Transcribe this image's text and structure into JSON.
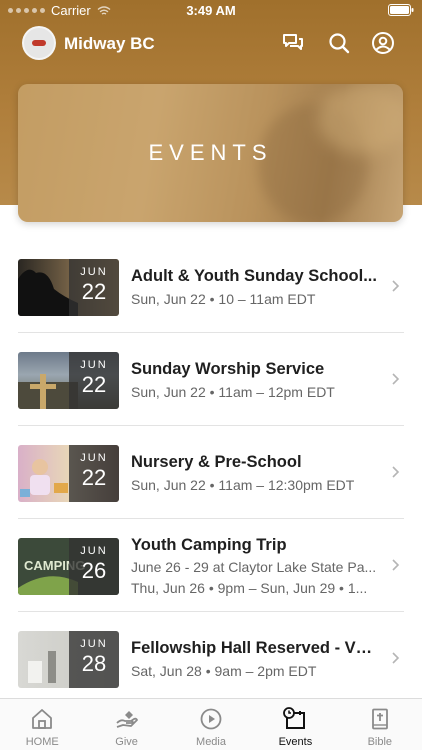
{
  "status_bar": {
    "carrier": "Carrier",
    "time": "3:49 AM"
  },
  "app": {
    "title": "Midway BC"
  },
  "hero": {
    "title": "EVENTS"
  },
  "events": [
    {
      "title": "Adult & Youth Sunday School...",
      "month": "JUN",
      "day": "22",
      "line1": "Sun, Jun 22 • 10 – 11am EDT"
    },
    {
      "title": "Sunday Worship Service",
      "month": "JUN",
      "day": "22",
      "line1": "Sun, Jun 22 • 11am – 12pm EDT"
    },
    {
      "title": "Nursery & Pre-School",
      "month": "JUN",
      "day": "22",
      "line1": "Sun, Jun 22 • 11am – 12:30pm EDT"
    },
    {
      "title": "Youth Camping Trip",
      "month": "JUN",
      "day": "26",
      "line1": "June 26 - 29 at Claytor Lake State Pa...",
      "line2": "Thu, Jun 26 • 9pm – Sun, Jun 29 • 1...",
      "thumb_text": "CAMPING"
    },
    {
      "title": "Fellowship Hall Reserved - VB...",
      "month": "JUN",
      "day": "28",
      "line1": "Sat, Jun 28 • 9am – 2pm EDT"
    }
  ],
  "tabs": [
    {
      "label": "HOME",
      "icon": "home-icon"
    },
    {
      "label": "Give",
      "icon": "give-icon"
    },
    {
      "label": "Media",
      "icon": "play-icon"
    },
    {
      "label": "Events",
      "icon": "calendar-clock-icon",
      "active": true
    },
    {
      "label": "Bible",
      "icon": "bible-icon"
    }
  ],
  "colors": {
    "header": "#a8782f",
    "active_tab": "#111111",
    "inactive_tab": "#8a8a8a"
  }
}
